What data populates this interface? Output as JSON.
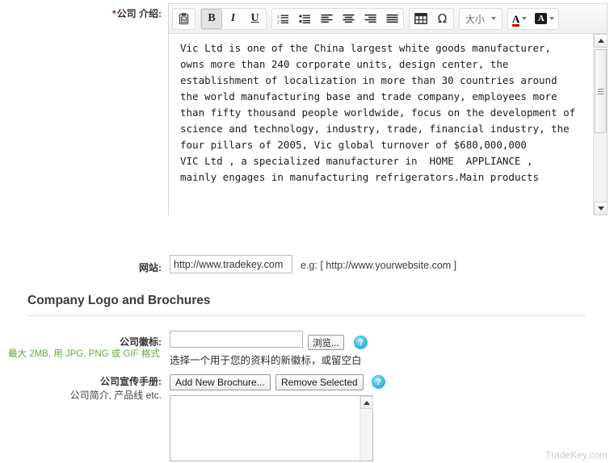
{
  "form": {
    "company_intro": {
      "label": "公司 介绍:",
      "required_marker": "*",
      "content": "Vic Ltd is one of the China largest white goods manufacturer, owns more than 240 corporate units, design center, the establishment of localization in more than 30 countries around the world manufacturing base and trade company, employees more than fifty thousand people worldwide, focus on the development of science and technology, industry, trade, financial industry, the four pillars of 2005, Vic global turnover of $680,000,000\nVIC Ltd , a specialized manufacturer in  HOME  APPLIANCE ,\nmainly engages in manufacturing refrigerators.Main products"
    },
    "website": {
      "label": "网站:",
      "value": "http://www.tradekey.com",
      "placeholder": "http://www.yourwebsite.com",
      "example": "e.g: [ http://www.yourwebsite.com ]"
    },
    "section_title": "Company Logo and Brochures",
    "logo": {
      "label": "公司徽标:",
      "value": "",
      "size_note": "最大 2MB, 用 JPG, PNG 或 GIF 格式",
      "browse_label": "浏览...",
      "hint": "选择一个用于您的资料的新徽标，或留空白",
      "help_label": "?"
    },
    "brochure": {
      "label": "公司宣传手册:",
      "sublabel": "公司简介, 产品线 etc.",
      "add_label": "Add New Brochure...",
      "remove_label": "Remove Selected",
      "help_label": "?",
      "items": []
    }
  },
  "editor_toolbar": {
    "groups": [
      {
        "name": "clipboard",
        "buttons": [
          {
            "name": "paste-from-word",
            "icon": "paste-word-icon",
            "active": false
          }
        ]
      },
      {
        "name": "text-style",
        "buttons": [
          {
            "name": "bold",
            "icon": "bold-icon",
            "label": "B",
            "active": true
          },
          {
            "name": "italic",
            "icon": "italic-icon",
            "label": "I",
            "active": false
          },
          {
            "name": "underline",
            "icon": "underline-icon",
            "label": "U",
            "active": false
          }
        ]
      },
      {
        "name": "lists-and-alignment",
        "buttons": [
          {
            "name": "ordered-list",
            "icon": "ordered-list-icon",
            "active": false
          },
          {
            "name": "unordered-list",
            "icon": "unordered-list-icon",
            "active": false
          },
          {
            "name": "align-left",
            "icon": "align-left-icon",
            "active": false
          },
          {
            "name": "align-center",
            "icon": "align-center-icon",
            "active": false
          },
          {
            "name": "align-right",
            "icon": "align-right-icon",
            "active": false
          },
          {
            "name": "align-justify",
            "icon": "align-justify-icon",
            "active": false
          }
        ]
      },
      {
        "name": "insert",
        "buttons": [
          {
            "name": "insert-table",
            "icon": "table-icon",
            "active": false
          },
          {
            "name": "insert-special-character",
            "icon": "omega-icon",
            "label": "Ω",
            "active": false
          }
        ]
      },
      {
        "name": "font-size",
        "buttons": [
          {
            "name": "font-size-select",
            "icon": "chevron-down-icon",
            "label": "大小",
            "active": false
          }
        ]
      },
      {
        "name": "colors",
        "buttons": [
          {
            "name": "text-color",
            "icon": "text-color-icon",
            "label": "A",
            "active": false
          },
          {
            "name": "background-color",
            "icon": "background-color-icon",
            "label": "A",
            "active": false
          }
        ]
      }
    ],
    "size_label": "大小"
  },
  "colors": {
    "required_marker": "#d40000",
    "note_green": "#6aa63b",
    "text_color_underline": "#cc0000",
    "help_icon": "#18a6d0",
    "watermark": "#c9c9c9"
  },
  "watermark": "TradeKey.com"
}
